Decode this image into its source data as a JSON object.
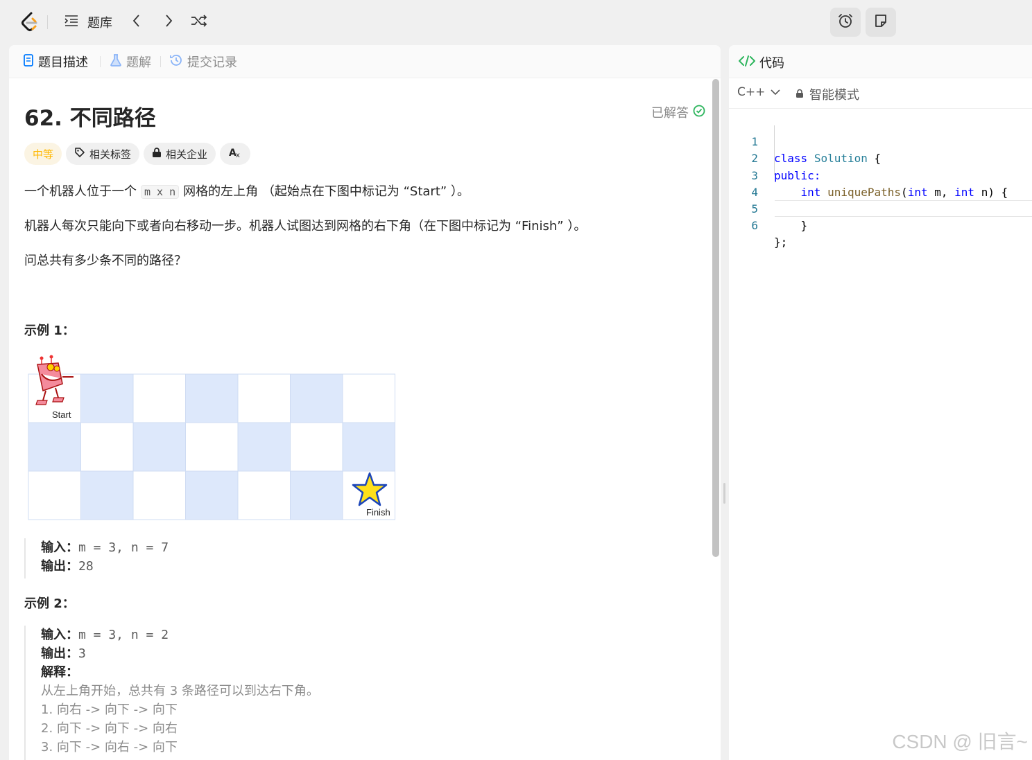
{
  "topbar": {
    "library_label": "题库"
  },
  "left_tabs": [
    {
      "label": "题目描述"
    },
    {
      "label": "题解"
    },
    {
      "label": "提交记录"
    }
  ],
  "problem": {
    "title": "62. 不同路径",
    "solved_label": "已解答",
    "tags": {
      "difficulty": "中等",
      "related_tags": "相关标签",
      "related_companies": "相关企业"
    },
    "desc1_pre": "一个机器人位于一个",
    "desc1_code": "m x n",
    "desc1_post": "网格的左上角 （起始点在下图中标记为 “Start” ）。",
    "desc2": "机器人每次只能向下或者向右移动一步。机器人试图达到网格的右下角（在下图中标记为 “Finish” ）。",
    "desc3": "问总共有多少条不同的路径？",
    "figure": {
      "start_label": "Start",
      "finish_label": "Finish"
    },
    "example1": {
      "heading": "示例 1：",
      "input_label": "输入：",
      "input_value": "m = 3, n = 7",
      "output_label": "输出：",
      "output_value": "28"
    },
    "example2": {
      "heading": "示例 2：",
      "input_label": "输入：",
      "input_value": "m = 3, n = 2",
      "output_label": "输出：",
      "output_value": "3",
      "explain_label": "解释：",
      "explain_lines": [
        "从左上角开始，总共有 3 条路径可以到达右下角。",
        "1. 向右 -> 向下 -> 向下",
        "2. 向下 -> 向下 -> 向右",
        "3. 向下 -> 向右 -> 向下"
      ]
    }
  },
  "code_panel": {
    "tab_label": "代码",
    "language": "C++",
    "mode_label": "智能模式",
    "lines": [
      {
        "n": "1"
      },
      {
        "n": "2"
      },
      {
        "n": "3"
      },
      {
        "n": "4"
      },
      {
        "n": "5"
      },
      {
        "n": "6"
      }
    ],
    "tokens": {
      "class_kw": "class",
      "class_name": "Solution",
      "public_kw": "public:",
      "int_kw": "int",
      "fn_name": "uniquePaths",
      "param_m": "m",
      "param_n": "n"
    }
  },
  "watermark": "CSDN @ 旧言~",
  "colors": {
    "accent_green": "#2db55d",
    "difficulty_yellow": "#ffb800",
    "grid_blue": "#dde8fb",
    "keyword_blue": "#0000ff"
  }
}
